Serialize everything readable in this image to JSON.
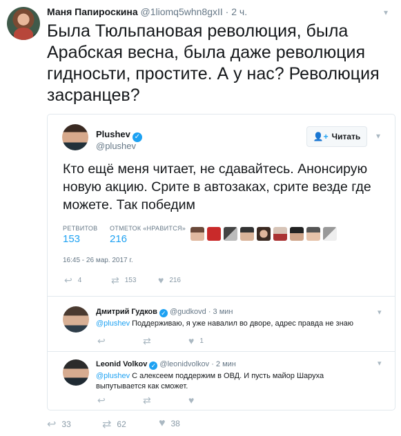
{
  "outer": {
    "name": "Маня Папироскина",
    "handle": "@1liomq5whn8gxII",
    "separator": "·",
    "time": "2 ч.",
    "text": "Была Тюльпановая революция, была Арабская весна, была даже революция гидносьти, простите. А у нас? Революция засранцев?",
    "actions": {
      "replies": "33",
      "retweets": "62",
      "likes": "38"
    }
  },
  "quote": {
    "name": "Plushev",
    "handle": "@plushev",
    "follow_label": "Читать",
    "text": "Кто ещё меня читает, не сдавайтесь. Анонсирую новую акцию. Срите в автозаках, срите везде где можете. Так победим",
    "stats": {
      "retweets_label": "РЕТВИТОВ",
      "retweets_value": "153",
      "likes_label": "ОТМЕТОК «НРАВИТСЯ»",
      "likes_value": "216"
    },
    "likers": [
      "liker-1",
      "liker-2",
      "liker-3",
      "liker-4",
      "liker-5",
      "liker-6",
      "liker-7",
      "liker-8",
      "liker-9"
    ],
    "date": "16:45 - 26 мар. 2017 г.",
    "actions": {
      "replies": "4",
      "retweets": "153",
      "likes": "216"
    }
  },
  "replies": [
    {
      "name": "Дмитрий Гудков",
      "handle": "@gudkovd",
      "time": "· 3 мин",
      "mention": "@plushev",
      "text": " Поддерживаю, я уже навалил во дворе, адрес правда не знаю",
      "likes": "1"
    },
    {
      "name": "Leonid Volkov",
      "handle": "@leonidvolkov",
      "time": "· 2 мин",
      "mention": "@plushev",
      "text": " С алексеем поддержим в ОВД. И пусть майор Шаруха выпутывается как сможет.",
      "likes": ""
    }
  ],
  "icons": {
    "caret": "▾",
    "verified": "✓",
    "follow": "👤+",
    "reply": "↩",
    "retweet": "⇄",
    "like": "♥"
  },
  "colors": {
    "accent": "#1da1f2",
    "muted": "#657786",
    "border": "#e1e8ed"
  }
}
